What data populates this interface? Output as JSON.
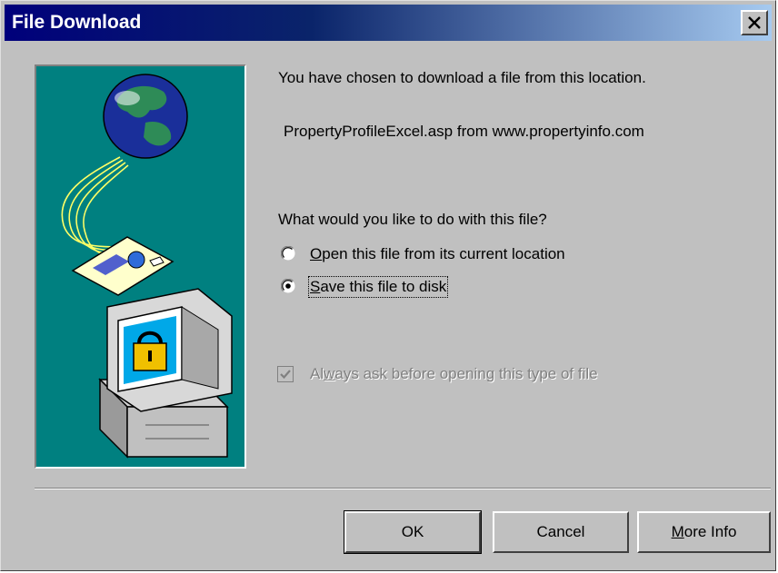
{
  "window": {
    "title": "File Download",
    "close_glyph": "×"
  },
  "message": {
    "line1": "You have chosen to download a file from this location.",
    "file_source": "PropertyProfileExcel.asp from www.propertyinfo.com",
    "question": "What would you like to do with this file?"
  },
  "options": [
    {
      "mnemonic": "O",
      "rest": "pen this file from its current location",
      "selected": false
    },
    {
      "mnemonic": "S",
      "rest": "ave this file to disk",
      "selected": true
    }
  ],
  "always_ask": {
    "pre": "Al",
    "mnemonic": "w",
    "rest": "ays ask before opening this type of file",
    "checked": true,
    "disabled": true
  },
  "buttons": {
    "ok": "OK",
    "cancel": "Cancel",
    "more_info_mnemonic": "M",
    "more_info_rest": "ore Info"
  },
  "illustration": {
    "icons": [
      "globe-icon",
      "document-icon",
      "computer-icon",
      "padlock-icon"
    ],
    "background": "#008080"
  },
  "colors": {
    "face": "#c0c0c0",
    "title_start": "#00007b",
    "title_end": "#a6caf0"
  }
}
